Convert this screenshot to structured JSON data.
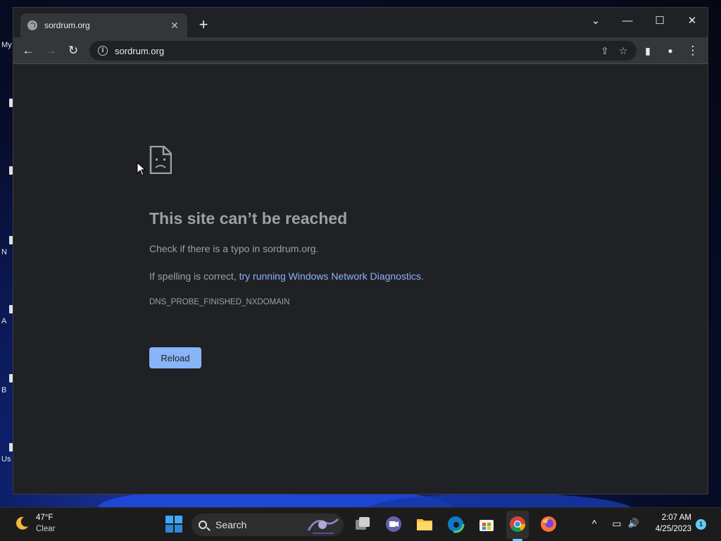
{
  "desktop": {
    "edge_labels": [
      "My",
      "N",
      "A",
      "B",
      "Us"
    ]
  },
  "browser": {
    "tab": {
      "title": "sordrum.org",
      "close": "✕"
    },
    "new_tab": "+",
    "window_controls": {
      "tab_search": "⌄",
      "minimize": "—",
      "maximize": "☐",
      "close": "✕"
    },
    "toolbar": {
      "back": "←",
      "forward": "→",
      "reload": "↻",
      "url": "sordrum.org",
      "share": "⇪",
      "bookmark": "☆",
      "side_panel": "▮",
      "profile": "●",
      "menu": "⋮"
    }
  },
  "page": {
    "heading": "This site can’t be reached",
    "line1": "Check if there is a typo in sordrum.org.",
    "line2_prefix": "If spelling is correct, ",
    "line2_link": "try running Windows Network Diagnostics",
    "line2_suffix": ".",
    "error_code": "DNS_PROBE_FINISHED_NXDOMAIN",
    "reload_label": "Reload"
  },
  "taskbar": {
    "weather": {
      "temp": "47°F",
      "condition": "Clear"
    },
    "search_label": "Search",
    "clock": {
      "time": "2:07 AM",
      "date": "4/25/2023"
    },
    "notification_count": "1",
    "tray": {
      "chevron": "^",
      "network": "▭",
      "volume": "🔊"
    }
  },
  "colors": {
    "link": "#8ab4f8",
    "button": "#8ab4f8",
    "page_bg": "#202124",
    "toolbar_bg": "#35363a",
    "accent": "#60cdff"
  }
}
